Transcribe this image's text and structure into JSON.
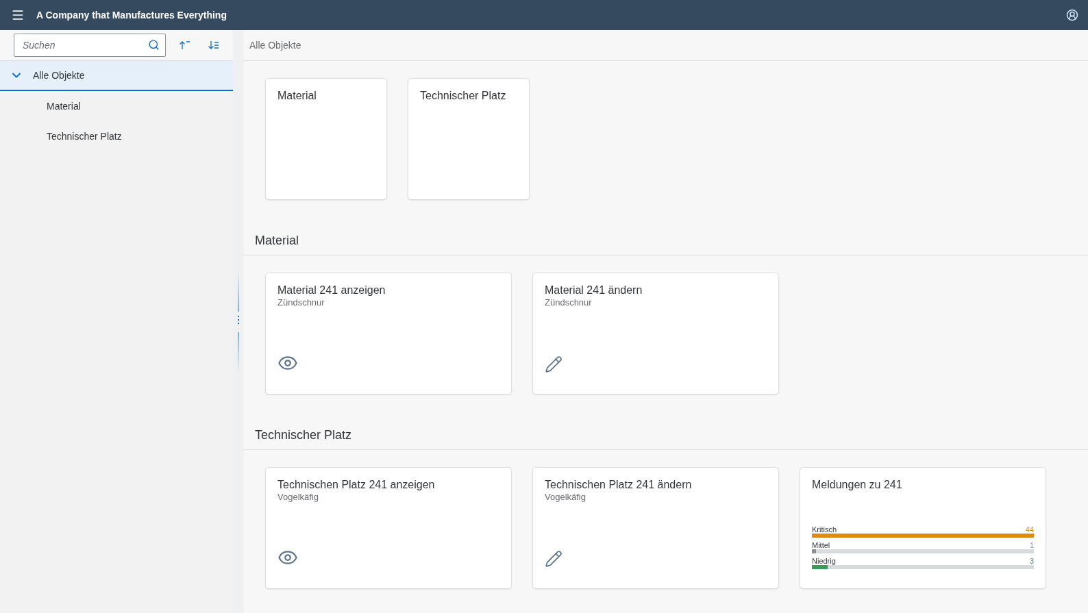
{
  "header": {
    "title": "A Company that Manufactures Everything"
  },
  "sidebar": {
    "search": {
      "placeholder": "Suchen"
    },
    "tree": [
      {
        "label": "Alle Objekte",
        "expanded": true,
        "selected": true,
        "children": [
          {
            "label": "Material",
            "selected": false
          },
          {
            "label": "Technischer Platz",
            "selected": false
          }
        ]
      }
    ]
  },
  "breadcrumb": "Alle Objekte",
  "sections": [
    {
      "tiles": [
        {
          "kind": "small",
          "title": "Material"
        },
        {
          "kind": "small",
          "title": "Technischer Platz"
        }
      ]
    },
    {
      "title": "Material",
      "tiles": [
        {
          "kind": "display",
          "title": "Material 241 anzeigen",
          "subtitle": "Zündschnur"
        },
        {
          "kind": "edit",
          "title": "Material 241 ändern",
          "subtitle": "Zündschnur"
        }
      ]
    },
    {
      "title": "Technischer Platz",
      "tiles": [
        {
          "kind": "display",
          "title": "Technischen Platz 241 anzeigen",
          "subtitle": "Vogelkäfig"
        },
        {
          "kind": "edit",
          "title": "Technischen Platz 241 ändern",
          "subtitle": "Vogelkäfig"
        },
        {
          "kind": "bars",
          "title": "Meldungen zu 241",
          "bars": [
            {
              "label": "Kritisch",
              "value": "44",
              "level": 1,
              "color": "#e08a10"
            },
            {
              "label": "Mittel",
              "value": "1",
              "level": 0.02,
              "color": "#8a8f95"
            },
            {
              "label": "Niedrig",
              "value": "3",
              "level": 0.07,
              "color": "#3a9a5a"
            }
          ]
        }
      ]
    }
  ]
}
